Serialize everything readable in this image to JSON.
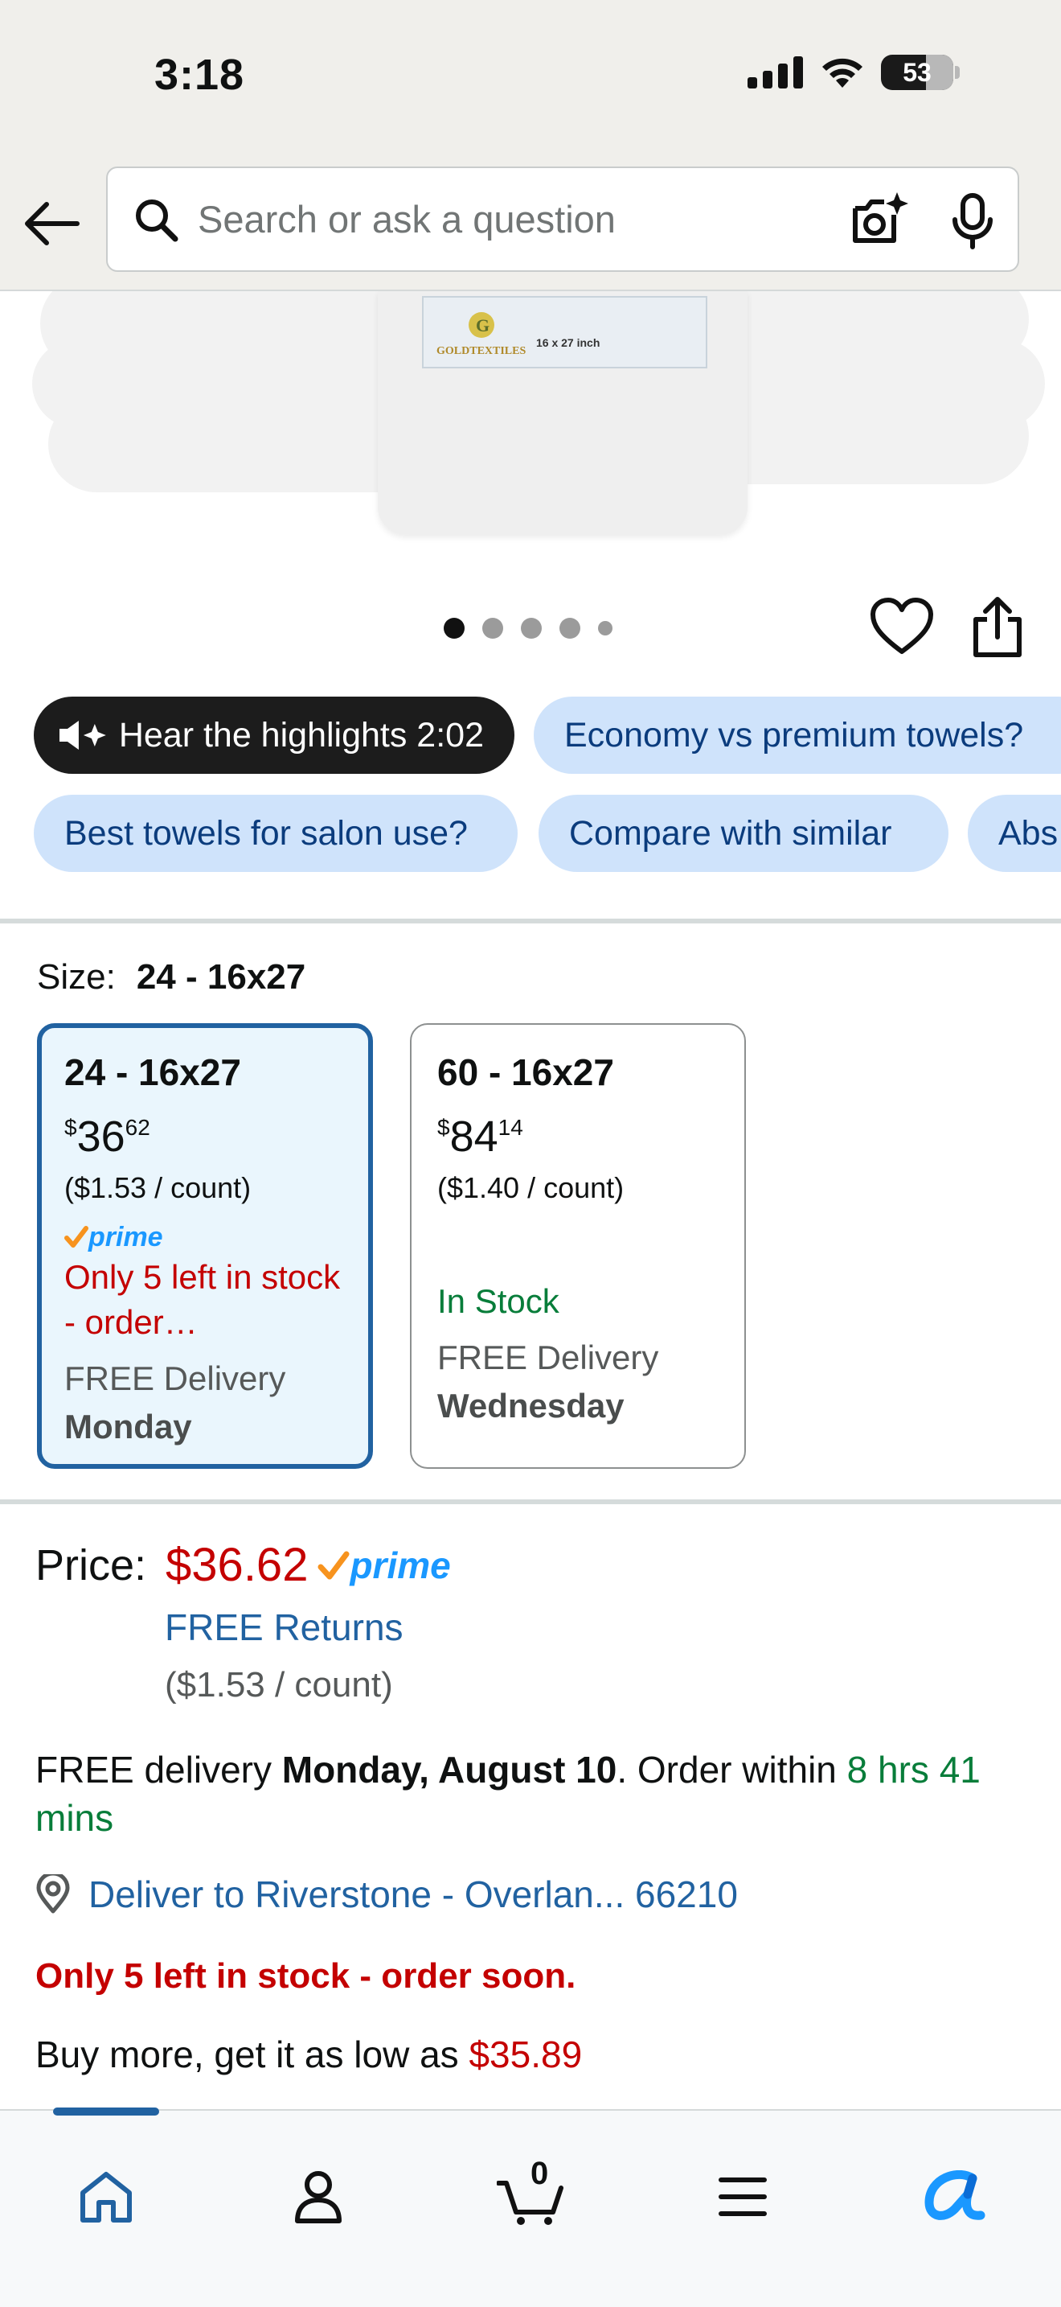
{
  "status_bar": {
    "time": "3:18",
    "battery": "53"
  },
  "header": {
    "search_placeholder": "Search or ask a question"
  },
  "product_image": {
    "brand_label": "GOLDTEXTILES",
    "size_label": "16 x 27 inch",
    "carousel_total": 5,
    "carousel_active": 1
  },
  "chips": {
    "hear": "Hear the highlights 2:02",
    "economy": "Economy vs premium towels?",
    "salon": "Best towels for salon use?",
    "compare": "Compare with similar",
    "abs": "Abs"
  },
  "size": {
    "label": "Size:",
    "selected": "24 - 16x27",
    "options": [
      {
        "title": "24 - 16x27",
        "price_symbol": "$",
        "price_whole": "36",
        "price_cents": "62",
        "unit": "($1.53 / count)",
        "prime": "prime",
        "stock": "Only 5 left in stock - order…",
        "delivery_label": "FREE Delivery",
        "delivery_day": "Monday"
      },
      {
        "title": "60 - 16x27",
        "price_symbol": "$",
        "price_whole": "84",
        "price_cents": "14",
        "unit": "($1.40 / count)",
        "stock": "In Stock",
        "delivery_label": "FREE Delivery",
        "delivery_day": "Wednesday"
      }
    ]
  },
  "price": {
    "label": "Price:",
    "value": "$36.62",
    "prime": "prime",
    "free_returns": "FREE Returns",
    "unit": "($1.53 / count)"
  },
  "delivery": {
    "prefix": "FREE delivery ",
    "date": "Monday, August 10",
    "middle": ". Order within ",
    "countdown": "8 hrs 41 mins"
  },
  "deliver_to": "Deliver to Riverstone - Overlan... 66210",
  "low_stock": "Only 5 left in stock - order soon.",
  "buy_more": {
    "text": "Buy more, get it as low as ",
    "price": "$35.89"
  },
  "bottom_nav": {
    "cart_count": "0"
  },
  "colors": {
    "link_blue": "#2162a1",
    "price_red": "#c40000",
    "stock_green": "#087d3a",
    "chip_blue": "#cfe3fb",
    "prime_blue": "#1a98ff",
    "prime_orange": "#f7931e"
  }
}
